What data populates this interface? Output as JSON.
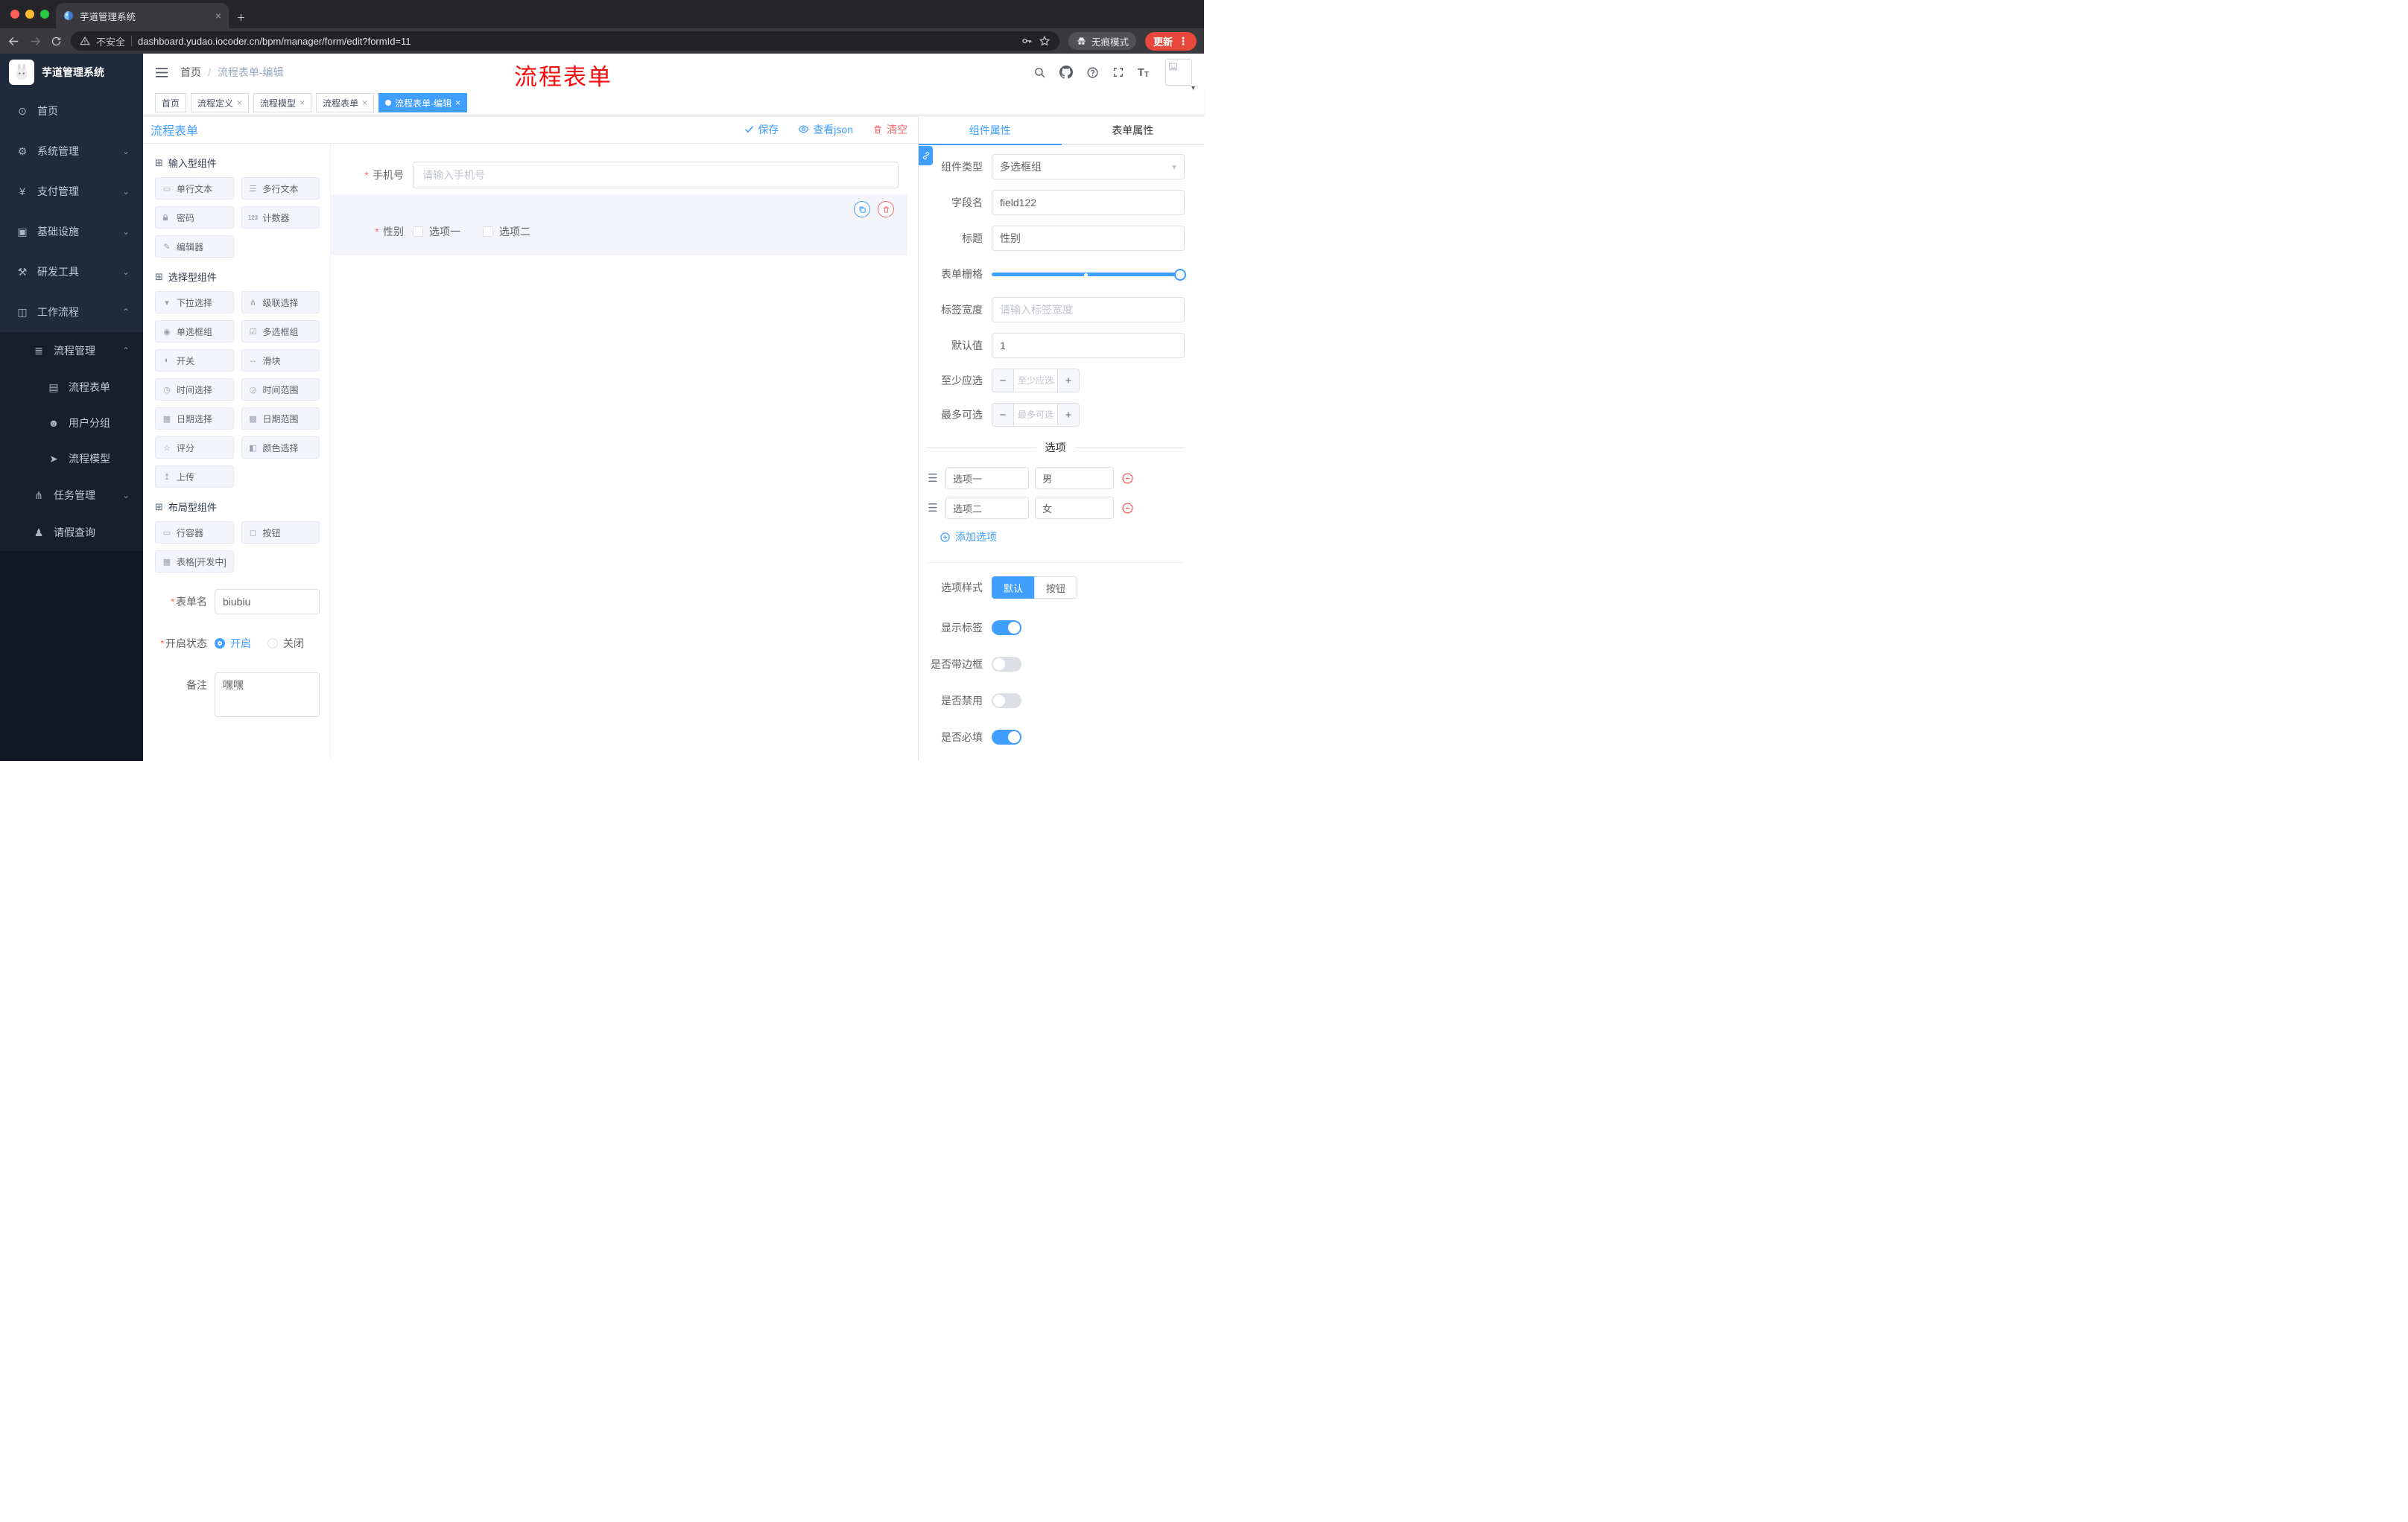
{
  "colors": {
    "accent": "#409eff",
    "danger": "#f56c6c",
    "annotation_red": "#f30d0d",
    "active_tag_bg": "#409eff",
    "update_pill": "#e8483c",
    "sidebar_bg": "#1f2b3a"
  },
  "browser": {
    "tab": {
      "title": "芋道管理系统",
      "favicon": "yudao-favicon",
      "close_icon": "close-icon"
    },
    "new_tab_icon": "plus-icon",
    "nav_icons": [
      "back-arrow-icon",
      "forward-arrow-icon",
      "reload-icon"
    ],
    "address": {
      "security_label": "不安全",
      "url": "dashboard.yudao.iocoder.cn/bpm/manager/form/edit?formId=11",
      "warning_icon": "warning-triangle-icon",
      "key_icon": "key-icon",
      "star_icon": "star-icon"
    },
    "incognito_label": "无痕模式",
    "incognito_icon": "incognito-icon",
    "update_label": "更新",
    "menu_icon": "kebab-menu-icon"
  },
  "sidebar": {
    "logo_title": "芋道管理系统",
    "menu": [
      {
        "label": "首页",
        "icon": "dashboard-icon",
        "level": 1
      },
      {
        "label": "系统管理",
        "icon": "gear-icon",
        "level": 1,
        "arrow": "down"
      },
      {
        "label": "支付管理",
        "icon": "payment-yen-icon",
        "level": 1,
        "arrow": "down"
      },
      {
        "label": "基础设施",
        "icon": "infrastructure-icon",
        "level": 1,
        "arrow": "down"
      },
      {
        "label": "研发工具",
        "icon": "devtools-icon",
        "level": 1,
        "arrow": "down"
      },
      {
        "label": "工作流程",
        "icon": "workflow-icon",
        "level": 1,
        "arrow": "up"
      },
      {
        "label": "流程管理",
        "icon": "process-management-icon",
        "level": 2,
        "arrow": "up"
      },
      {
        "label": "流程表单",
        "icon": "process-form-icon",
        "level": 3
      },
      {
        "label": "用户分组",
        "icon": "user-group-icon",
        "level": 3
      },
      {
        "label": "流程模型",
        "icon": "process-model-icon",
        "level": 3
      },
      {
        "label": "任务管理",
        "icon": "task-management-icon",
        "level": 2,
        "arrow": "down"
      },
      {
        "label": "请假查询",
        "icon": "leave-query-icon",
        "level": 2
      }
    ]
  },
  "header": {
    "breadcrumb": {
      "home": "首页",
      "separator": "/",
      "current": "流程表单-编辑"
    },
    "annotation": "流程表单",
    "right_icons": [
      "search-icon",
      "github-icon",
      "help-icon",
      "fullscreen-icon",
      "font-size-icon"
    ],
    "avatar": "avatar"
  },
  "tags_view": [
    {
      "label": "首页",
      "closable": false,
      "active": false
    },
    {
      "label": "流程定义",
      "closable": true,
      "active": false
    },
    {
      "label": "流程模型",
      "closable": true,
      "active": false
    },
    {
      "label": "流程表单",
      "closable": true,
      "active": false
    },
    {
      "label": "流程表单-编辑",
      "closable": true,
      "active": true
    }
  ],
  "designer": {
    "title": "流程表单",
    "actions": [
      {
        "label": "保存",
        "icon": "check-icon"
      },
      {
        "label": "查看json",
        "icon": "eye-icon"
      },
      {
        "label": "清空",
        "icon": "trash-icon"
      }
    ],
    "component_groups": [
      {
        "title": "输入型组件",
        "icon": "component-group-icon",
        "items": [
          {
            "label": "单行文本",
            "icon": "single-line-text-icon"
          },
          {
            "label": "多行文本",
            "icon": "textarea-icon"
          },
          {
            "label": "密码",
            "icon": "password-lock-icon"
          },
          {
            "label": "计数器",
            "icon": "counter-icon"
          },
          {
            "label": "编辑器",
            "icon": "editor-icon"
          }
        ]
      },
      {
        "title": "选择型组件",
        "icon": "component-group-icon",
        "items": [
          {
            "label": "下拉选择",
            "icon": "select-dropdown-icon"
          },
          {
            "label": "级联选择",
            "icon": "cascader-icon"
          },
          {
            "label": "单选框组",
            "icon": "radio-group-icon"
          },
          {
            "label": "多选框组",
            "icon": "checkbox-group-icon"
          },
          {
            "label": "开关",
            "icon": "switch-icon"
          },
          {
            "label": "滑块",
            "icon": "slider-icon"
          },
          {
            "label": "时间选择",
            "icon": "time-picker-icon"
          },
          {
            "label": "时间范围",
            "icon": "time-range-icon"
          },
          {
            "label": "日期选择",
            "icon": "date-picker-icon"
          },
          {
            "label": "日期范围",
            "icon": "date-range-icon"
          },
          {
            "label": "评分",
            "icon": "rate-icon"
          },
          {
            "label": "颜色选择",
            "icon": "color-picker-icon"
          },
          {
            "label": "上传",
            "icon": "upload-icon"
          }
        ]
      },
      {
        "title": "布局型组件",
        "icon": "component-group-icon",
        "items": [
          {
            "label": "行容器",
            "icon": "row-container-icon"
          },
          {
            "label": "按钮",
            "icon": "button-icon"
          },
          {
            "label": "表格[开发中]",
            "icon": "table-icon"
          }
        ]
      }
    ],
    "meta": {
      "form_name": {
        "label": "表单名",
        "required": true,
        "value": "biubiu"
      },
      "status": {
        "label": "开启状态",
        "required": true,
        "options": [
          {
            "label": "开启",
            "selected": true
          },
          {
            "label": "关闭",
            "selected": false
          }
        ]
      },
      "remark": {
        "label": "备注",
        "value": "嘿嘿"
      }
    },
    "canvas": {
      "fields": [
        {
          "label": "手机号",
          "required": true,
          "type": "input",
          "placeholder": "请输入手机号"
        },
        {
          "label": "性别",
          "required": true,
          "type": "checkbox-group",
          "selected": true,
          "action_icons": [
            "copy-icon",
            "delete-icon"
          ],
          "options": [
            {
              "label": "选项一",
              "checked": false
            },
            {
              "label": "选项二",
              "checked": false
            }
          ]
        }
      ]
    }
  },
  "props": {
    "handle_icon": "link-icon",
    "tabs": [
      {
        "label": "组件属性",
        "active": true
      },
      {
        "label": "表单属性",
        "active": false
      }
    ],
    "rows": {
      "component_type": {
        "label": "组件类型",
        "value": "多选框组"
      },
      "field_name": {
        "label": "字段名",
        "value": "field122"
      },
      "title": {
        "label": "标题",
        "value": "性别"
      },
      "grid": {
        "label": "表单栅格"
      },
      "label_width": {
        "label": "标签宽度",
        "placeholder": "请输入标签宽度"
      },
      "default_value": {
        "label": "默认值",
        "value": "1"
      },
      "min_selected": {
        "label": "至少应选",
        "placeholder": "至少应选"
      },
      "max_selected": {
        "label": "最多可选",
        "placeholder": "最多可选"
      }
    },
    "options": {
      "divider_title": "选项",
      "rows": [
        {
          "label": "选项一",
          "value": "男"
        },
        {
          "label": "选项二",
          "value": "女"
        }
      ],
      "add_label": "添加选项"
    },
    "style": {
      "label": "选项样式",
      "segments": [
        {
          "label": "默认",
          "active": true
        },
        {
          "label": "按钮",
          "active": false
        }
      ]
    },
    "switches": [
      {
        "label": "显示标签",
        "on": true
      },
      {
        "label": "是否带边框",
        "on": false
      },
      {
        "label": "是否禁用",
        "on": false
      },
      {
        "label": "是否必填",
        "on": true
      }
    ]
  }
}
